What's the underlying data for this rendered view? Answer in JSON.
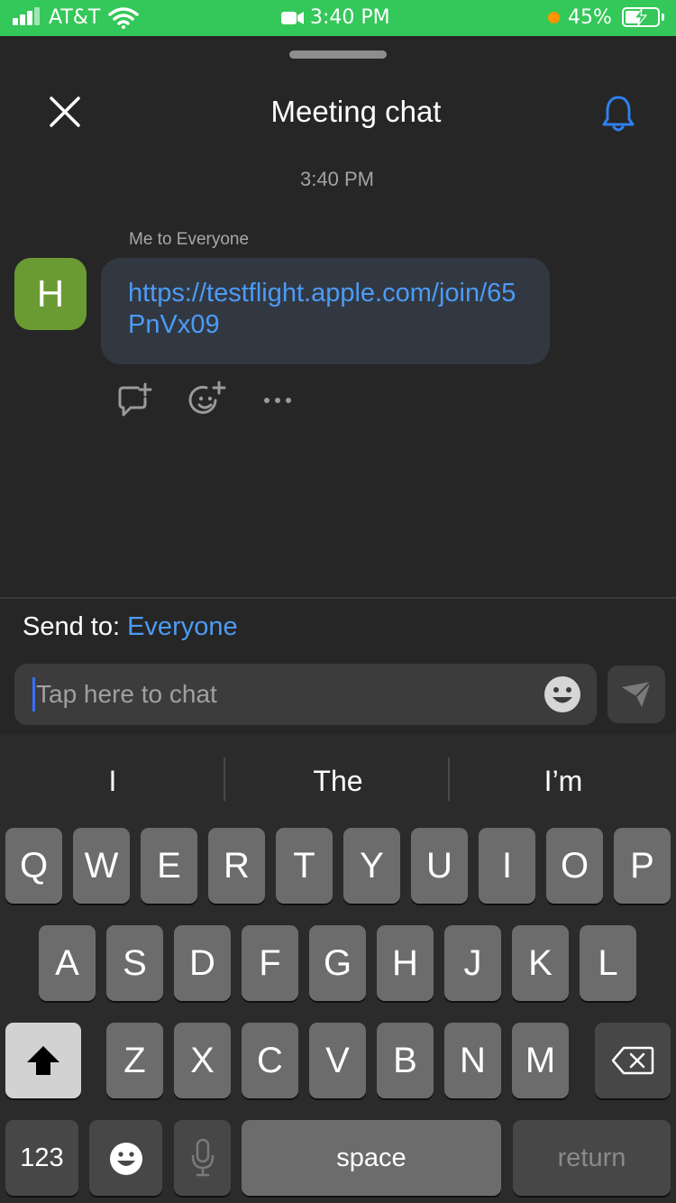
{
  "status_bar": {
    "carrier": "AT&T",
    "time": "3:40 PM",
    "battery": "45%",
    "battery_fraction": 0.45,
    "icons": [
      "signal-icon",
      "wifi-icon",
      "video-camera-icon",
      "charging-bolt-icon"
    ]
  },
  "chat": {
    "title": "Meeting chat",
    "timestamp": "3:40 PM",
    "message": {
      "avatar_letter": "H",
      "sender_line": "Me to Everyone",
      "text": "https://testflight.apple.com/join/65PnVx09"
    }
  },
  "composer": {
    "send_to_label": "Send to:",
    "send_to_value": "Everyone",
    "placeholder": "Tap here to chat"
  },
  "keyboard": {
    "suggestions": [
      "I",
      "The",
      "I’m"
    ],
    "row1": [
      "Q",
      "W",
      "E",
      "R",
      "T",
      "Y",
      "U",
      "I",
      "O",
      "P"
    ],
    "row2": [
      "A",
      "S",
      "D",
      "F",
      "G",
      "H",
      "J",
      "K",
      "L"
    ],
    "row3": [
      "Z",
      "X",
      "C",
      "V",
      "B",
      "N",
      "M"
    ],
    "numbers_key": "123",
    "space_key": "space",
    "return_key": "return"
  },
  "colors": {
    "status_bar_bg": "#34c759",
    "background": "#262626",
    "accent_blue": "#4c9bf5",
    "bubble_bg": "#323842",
    "avatar_bg": "#6a9b33"
  }
}
